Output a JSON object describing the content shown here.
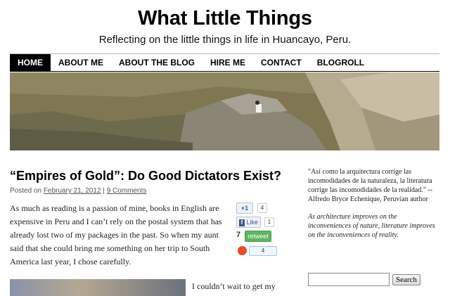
{
  "site": {
    "title": "What Little Things",
    "tagline": "Reflecting on the little things in life in Huancayo, Peru."
  },
  "nav": {
    "items": [
      {
        "label": "HOME",
        "active": true
      },
      {
        "label": "ABOUT ME"
      },
      {
        "label": "ABOUT THE BLOG"
      },
      {
        "label": "HIRE ME"
      },
      {
        "label": "CONTACT"
      },
      {
        "label": "BLOGROLL"
      }
    ]
  },
  "post": {
    "title": "“Empires of Gold”: Do Good Dictators Exist?",
    "meta_prefix": "Posted on ",
    "date": "February 21, 2012",
    "separator": " | ",
    "comments": "9 Comments",
    "paragraph1": "As much as reading is a passion of mine, books in English are expensive in Peru and I can’t rely on the postal system that has already lost two of my packages in the past. So when my aunt said that she could bring me something on her trip to South America last year, I chose carefully.",
    "paragraph2": "I couldn’t wait to get my"
  },
  "social": {
    "gplus_label": "+1",
    "gplus_count": "4",
    "fb_label": "Like",
    "fb_count": "1",
    "twitter_count": "7",
    "twitter_label": "retweet",
    "stumble_count": "4"
  },
  "sidebar": {
    "quote_es": "\"Así como la arquitectura corrige las incomodidades de la naturaleza, la literatura corrige las incomodidades de la realidad.\" -- Alfredo Bryce Echenique, Peruvian author",
    "quote_en": "As architecture improves on the inconveniences of nature, literature improves on the inconveniences of reality.",
    "search_button": "Search",
    "search_value": ""
  },
  "colors": {
    "nav_active_bg": "#000000",
    "link": "#555555",
    "social_blue": "#3b5998",
    "twitter_green": "#5fb55f",
    "stumble_orange": "#eb4924"
  }
}
